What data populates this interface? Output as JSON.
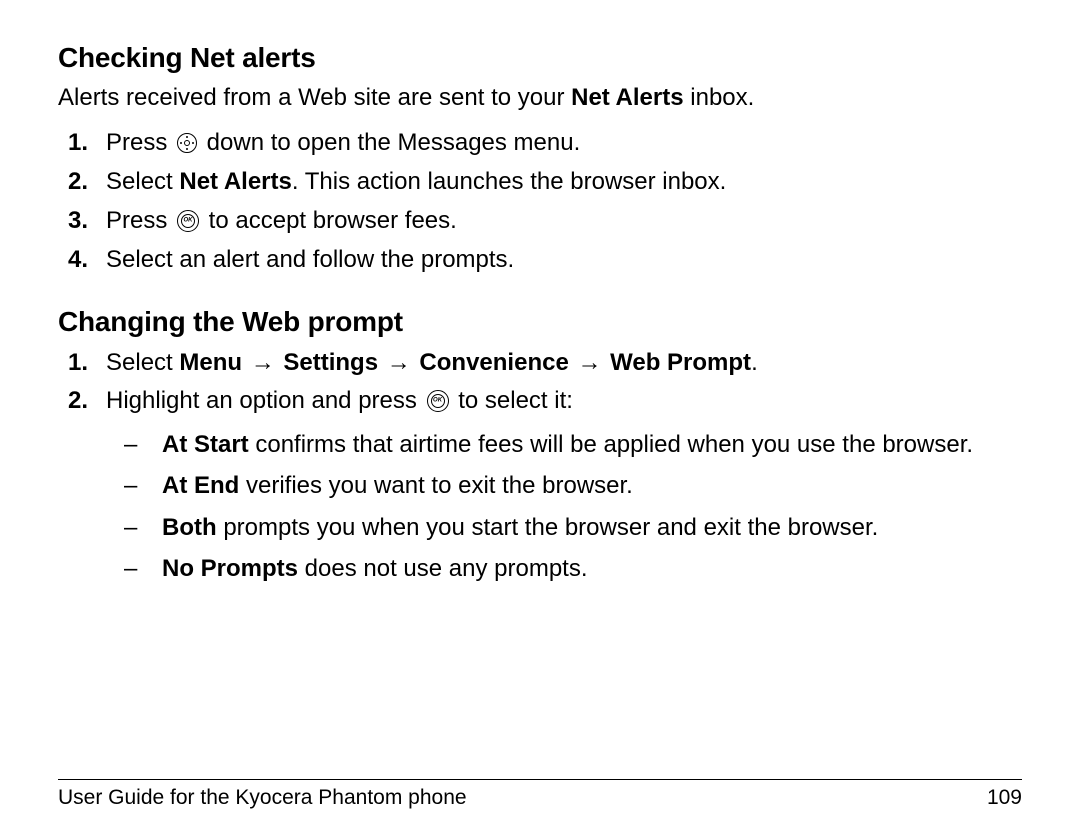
{
  "section1": {
    "heading": "Checking Net alerts",
    "intro_pre": "Alerts received from a Web site are sent to your ",
    "intro_bold": "Net Alerts",
    "intro_post": " inbox.",
    "step1_pre": "Press ",
    "step1_post": " down to open the Messages menu.",
    "step2_pre": "Select ",
    "step2_bold": "Net Alerts",
    "step2_post": ". This action launches the browser inbox.",
    "step3_pre": "Press ",
    "step3_post": " to accept browser fees.",
    "step4": "Select an alert and follow the prompts."
  },
  "section2": {
    "heading": "Changing the Web prompt",
    "step1_pre": "Select ",
    "menu1": "Menu",
    "arrow": "→",
    "menu2": "Settings",
    "menu3": "Convenience",
    "menu4": "Web Prompt",
    "step1_post": ".",
    "step2_pre": "Highlight an option and press ",
    "step2_post": " to select it:",
    "opt1_bold": "At Start",
    "opt1_text": " confirms that airtime fees will be applied when you use the browser.",
    "opt2_bold": "At End",
    "opt2_text": " verifies you want to exit the browser.",
    "opt3_bold": "Both",
    "opt3_text": " prompts you when you start the browser and exit the browser.",
    "opt4_bold": "No Prompts",
    "opt4_text": " does not use any prompts."
  },
  "footer": {
    "title": "User Guide for the Kyocera Phantom phone",
    "page": "109"
  }
}
